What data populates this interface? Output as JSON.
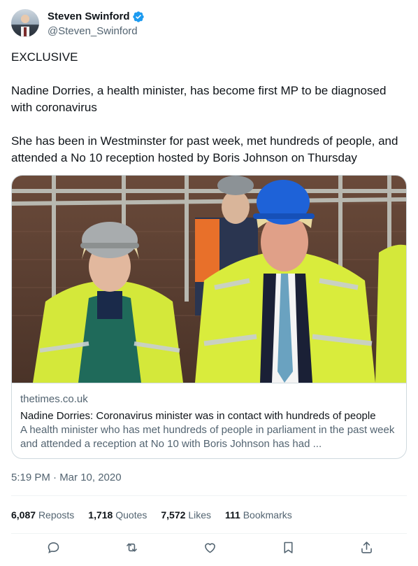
{
  "author": {
    "name": "Steven Swinford",
    "handle": "@Steven_Swinford",
    "verified": true,
    "verified_color": "#1d9bf0"
  },
  "tweet": {
    "paragraphs": [
      "EXCLUSIVE",
      "Nadine Dorries, a health minister, has become first MP to be diagnosed with coronavirus",
      "She has been in Westminster for past week, met hundreds of people, and attended a No 10 reception hosted by Boris Johnson on Thursday"
    ],
    "timestamp": "5:19 PM · Mar 10, 2020"
  },
  "link_card": {
    "domain": "thetimes.co.uk",
    "title": "Nadine Dorries: Coronavirus minister was in contact with hundreds of people",
    "description": "A health minister who has met hundreds of people in parliament in the past week and attended a reception at No 10 with Boris Johnson has had ..."
  },
  "stats": [
    {
      "count": "6,087",
      "label": "Reposts"
    },
    {
      "count": "1,718",
      "label": "Quotes"
    },
    {
      "count": "7,572",
      "label": "Likes"
    },
    {
      "count": "111",
      "label": "Bookmarks"
    }
  ],
  "actions": [
    "reply-icon",
    "repost-icon",
    "like-icon",
    "bookmark-icon",
    "share-icon"
  ],
  "colors": {
    "text": "#0f1419",
    "secondary": "#536471",
    "border": "#cfd9de",
    "accent": "#1d9bf0"
  }
}
